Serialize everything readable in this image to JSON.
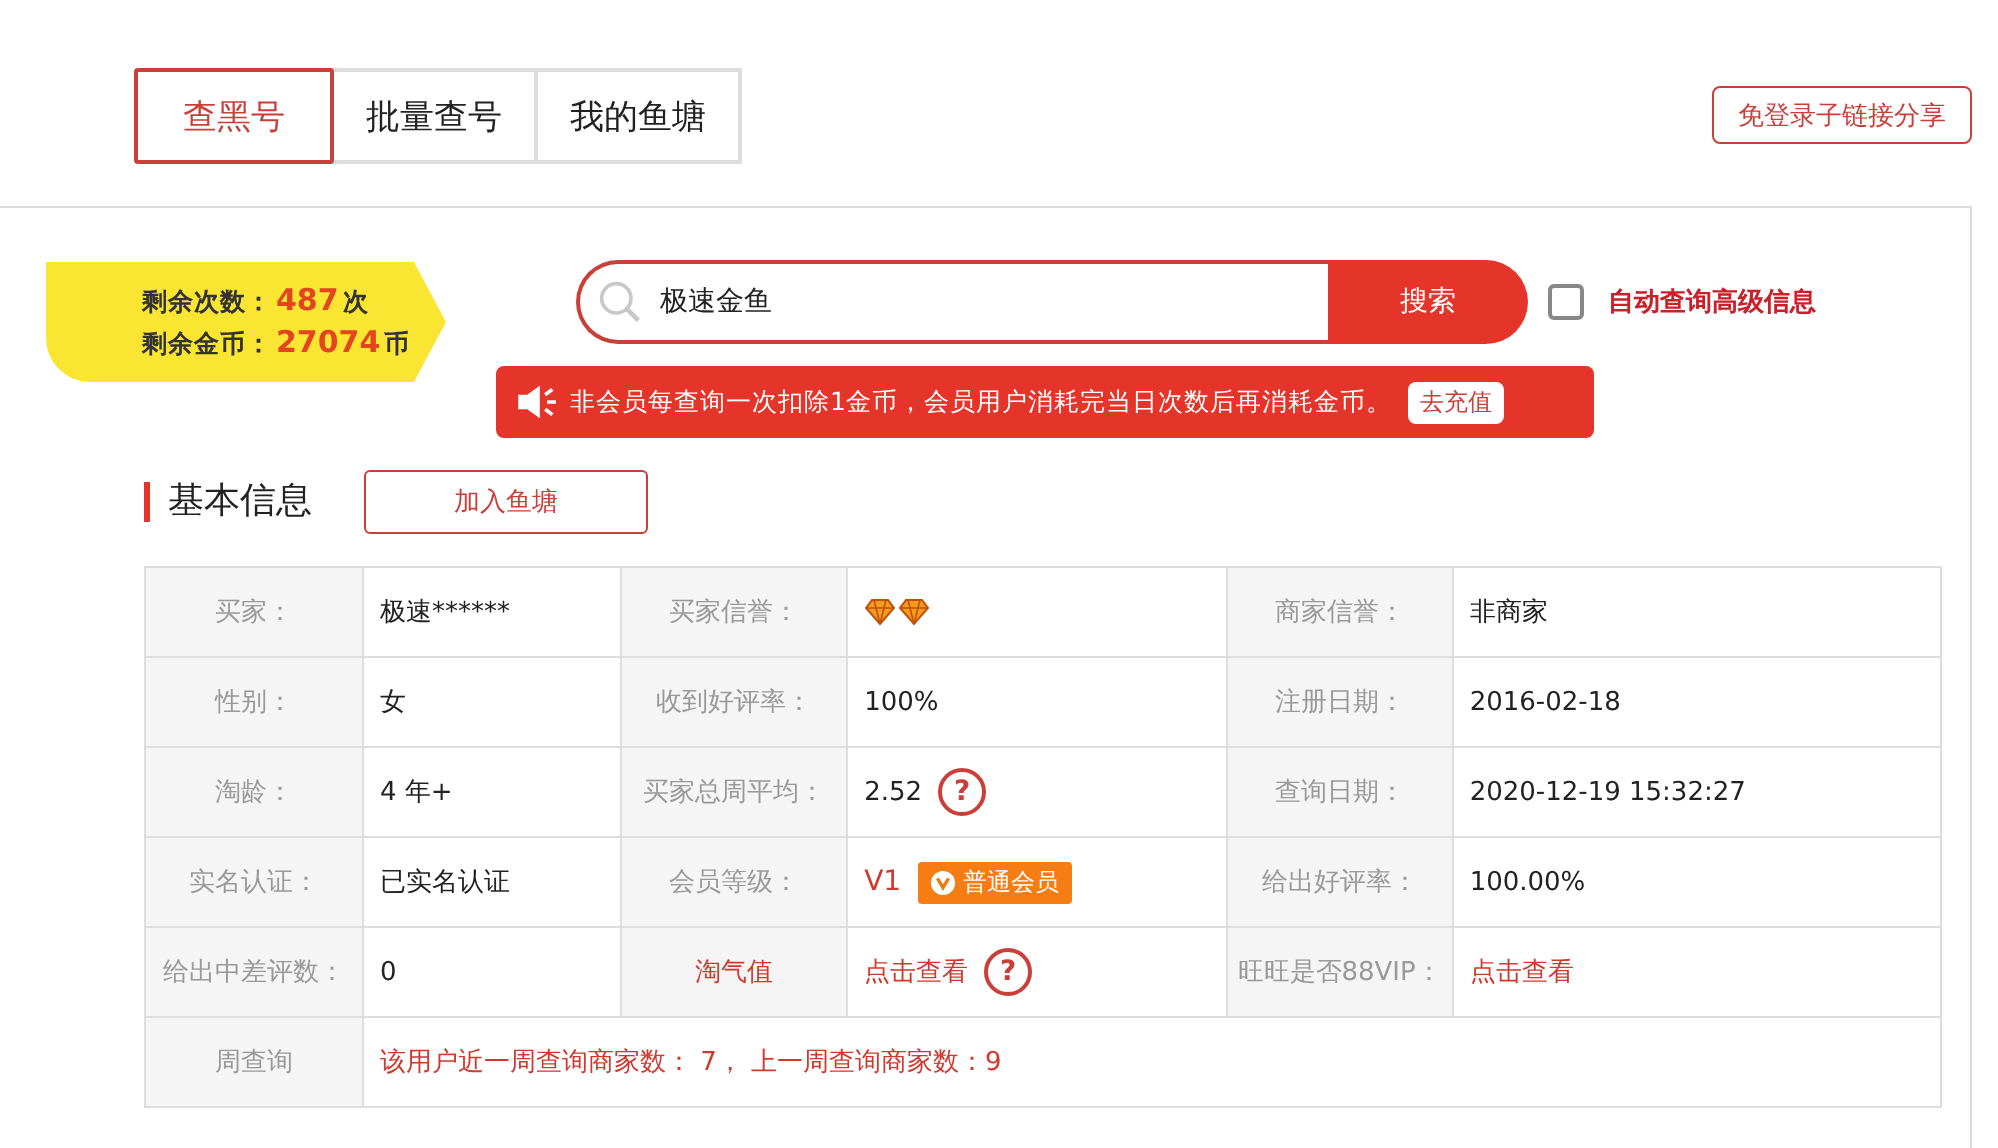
{
  "tabs": [
    {
      "label": "查黑号",
      "selected": true
    },
    {
      "label": "批量查号",
      "selected": false
    },
    {
      "label": "我的鱼塘",
      "selected": false
    }
  ],
  "share_button": "免登录子链接分享",
  "balance": {
    "times_label": "剩余次数：",
    "times": "487",
    "times_unit": "次",
    "coins_label": "剩余金币：",
    "coins": "27074",
    "coins_unit": "币"
  },
  "search": {
    "value": "极速金鱼",
    "button": "搜索"
  },
  "auto_query": {
    "label": "自动查询高级信息",
    "checked": false
  },
  "notice": {
    "text": "非会员每查询一次扣除1金币，会员用户消耗完当日次数后再消耗金币。",
    "button": "去充值"
  },
  "section": {
    "title": "基本信息",
    "button": "加入鱼塘"
  },
  "rows": [
    {
      "cells": [
        {
          "label": "买家：",
          "label_link": false,
          "kind": "text",
          "value": "极速******"
        },
        {
          "label": "买家信誉：",
          "label_link": false,
          "kind": "diamonds"
        },
        {
          "label": "商家信誉：",
          "label_link": false,
          "kind": "text",
          "value": "非商家"
        }
      ]
    },
    {
      "cells": [
        {
          "label": "性别：",
          "label_link": false,
          "kind": "text",
          "value": "女"
        },
        {
          "label": "收到好评率：",
          "label_link": false,
          "kind": "text",
          "value": "100%"
        },
        {
          "label": "注册日期：",
          "label_link": false,
          "kind": "text",
          "value": "2016-02-18"
        }
      ]
    },
    {
      "cells": [
        {
          "label": "淘龄：",
          "label_link": false,
          "kind": "text",
          "value": "4 年+"
        },
        {
          "label": "买家总周平均：",
          "label_link": false,
          "kind": "help",
          "value": "2.52",
          "icon": "?"
        },
        {
          "label": "查询日期：",
          "label_link": false,
          "kind": "text",
          "value": "2020-12-19 15:32:27"
        }
      ]
    },
    {
      "cells": [
        {
          "label": "实名认证：",
          "label_link": false,
          "kind": "text",
          "value": "已实名认证"
        },
        {
          "label": "会员等级：",
          "label_link": false,
          "kind": "member",
          "value": "V1",
          "badge": "普通会员"
        },
        {
          "label": "给出好评率：",
          "label_link": false,
          "kind": "text",
          "value": "100.00%"
        }
      ]
    },
    {
      "cells": [
        {
          "label": "给出中差评数：",
          "label_link": false,
          "kind": "text",
          "value": "0"
        },
        {
          "label": "淘气值",
          "label_link": true,
          "kind": "link_help",
          "value": "点击查看",
          "icon": "?"
        },
        {
          "label": "旺旺是否88VIP：",
          "label_link": false,
          "kind": "link",
          "value": "点击查看"
        }
      ]
    },
    {
      "cells": [
        {
          "label": "周查询",
          "label_link": false,
          "kind": "note",
          "value": "该用户近一周查询商家数： 7， 上一周查询商家数：9"
        }
      ]
    }
  ]
}
